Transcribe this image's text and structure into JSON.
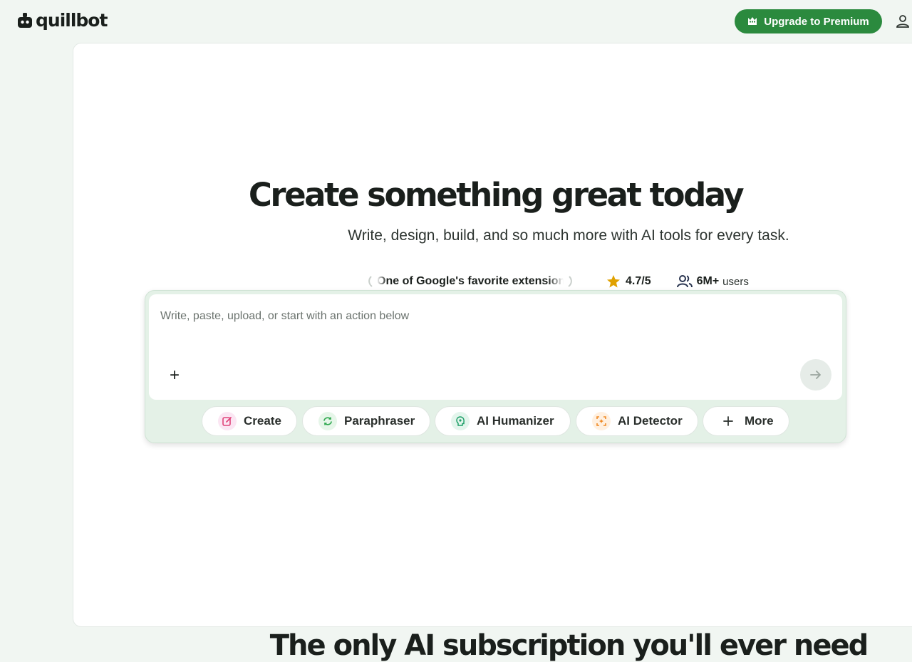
{
  "brand": {
    "name": "quillbot"
  },
  "header": {
    "upgrade_label": "Upgrade to Premium"
  },
  "hero": {
    "title": "Create something great today",
    "subtitle": "Write, design, build, and so much more with AI tools for every task."
  },
  "social_proof": {
    "extension_text": "One of Google's favorite extensions",
    "rating": "4.7/5",
    "users_count": "6M+",
    "users_label": "users"
  },
  "composer": {
    "placeholder": "Write, paste, upload, or start with an action below"
  },
  "actions": [
    {
      "label": "Create",
      "icon": "pencil-square-icon"
    },
    {
      "label": "Paraphraser",
      "icon": "refresh-arrows-icon"
    },
    {
      "label": "AI Humanizer",
      "icon": "brain-head-icon"
    },
    {
      "label": "AI Detector",
      "icon": "scan-focus-icon"
    },
    {
      "label": "More",
      "icon": "plus-icon"
    }
  ],
  "section": {
    "title": "The only AI subscription you'll ever need"
  },
  "colors": {
    "brand_green": "#2b8a3e",
    "page_bg": "#f1f6f2",
    "composer_bg": "#e4f1e7",
    "star": "#e0a100"
  }
}
